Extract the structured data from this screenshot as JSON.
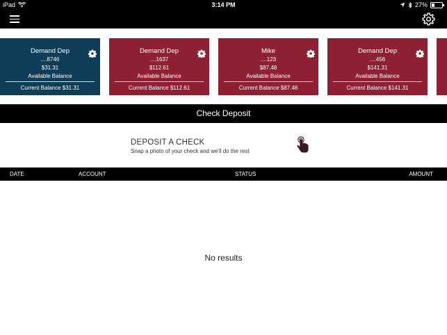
{
  "status_bar": {
    "carrier": "iPad",
    "time": "3:14 PM",
    "battery": "27%",
    "battery_level": 0.27
  },
  "nav": {
    "menu_icon": "hamburger-menu-icon",
    "settings_icon": "gear-icon"
  },
  "accounts": [
    {
      "name": "Demand Dep",
      "number": "....8746",
      "amount": "$31.31",
      "available_label": "Available Balance",
      "current": "Current Balance $31.31",
      "color": "#0f3c56"
    },
    {
      "name": "Demand Dep",
      "number": "....1637",
      "amount": "$112.61",
      "available_label": "Available Balance",
      "current": "Current Balance $112.61",
      "color": "#8e2033"
    },
    {
      "name": "Mike",
      "number": "....123",
      "amount": "$87.48",
      "available_label": "Available Balance",
      "current": "Current Balance $87.48",
      "color": "#8e2033"
    },
    {
      "name": "Demand Dep",
      "number": "....456",
      "amount": "$141.31",
      "available_label": "Available Balance",
      "current": "Current Balance $141.31",
      "color": "#8e2033"
    }
  ],
  "section_title": "Check Deposit",
  "deposit": {
    "title": "DEPOSIT A CHECK",
    "subtitle": "Snap a photo of your check and we'll do the rest",
    "icon": "tap-hand-icon"
  },
  "table": {
    "columns": [
      "DATE",
      "ACCOUNT",
      "STATUS",
      "AMOUNT"
    ],
    "empty_text": "No results"
  }
}
